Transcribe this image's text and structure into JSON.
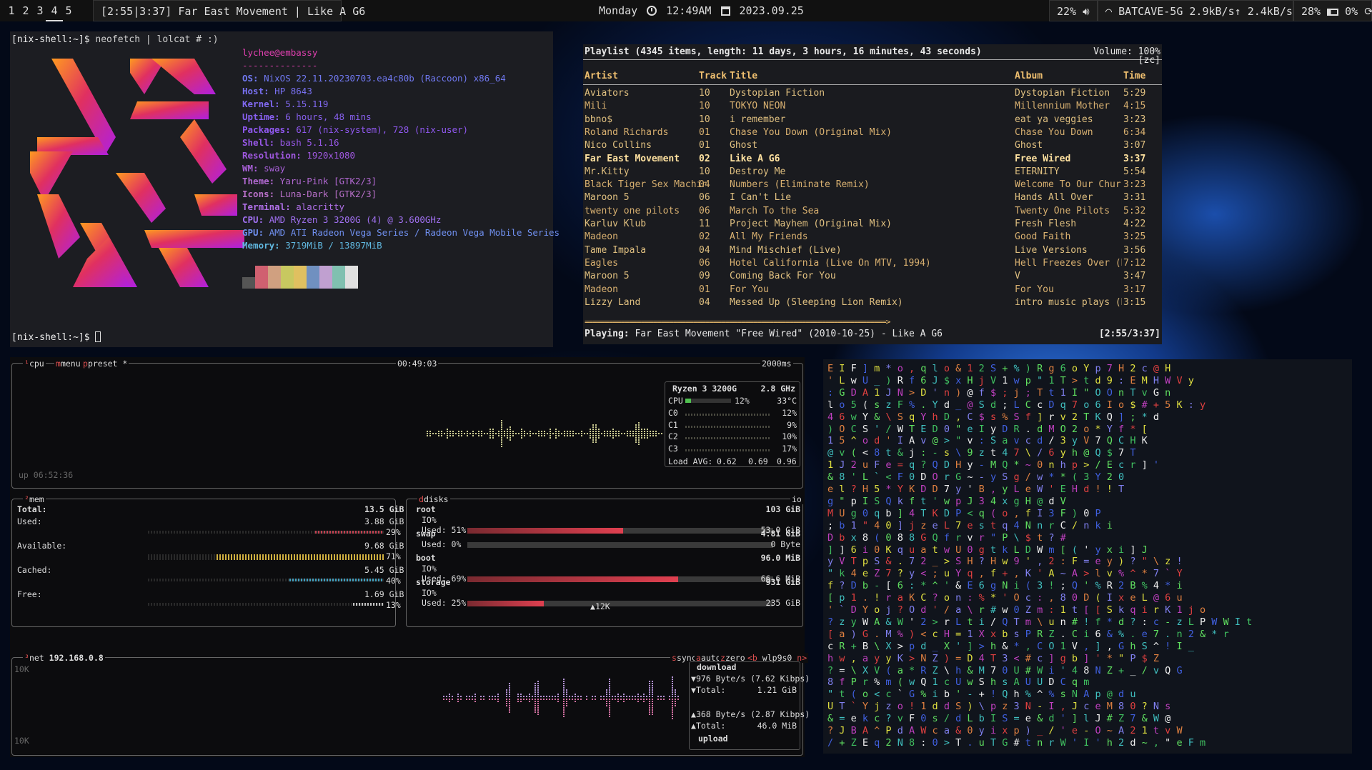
{
  "bar": {
    "workspaces": [
      "1",
      "2",
      "3",
      "4",
      "5"
    ],
    "active_workspace": "4",
    "now_playing": "[2:55|3:37] Far East Movement | Like A G6",
    "day": "Monday",
    "time": "12:49AM",
    "date": "2023.09.25",
    "volume": "22%",
    "wifi": "BATCAVE-5G 2.9kB/s",
    "wifi_down": "2.4kB/s",
    "battery": "28%",
    "brightness": "0%",
    "icons": [
      "clock-icon",
      "calendar-icon",
      "speaker-icon",
      "wifi-icon",
      "upload-arrow-icon",
      "download-arrow-icon",
      "battery-icon",
      "refresh-icon"
    ]
  },
  "neofetch": {
    "cmd_prompt": "[nix-shell:~]$",
    "command": " neofetch | lolcat # :)",
    "user": "lychee@embassy",
    "sep": "--------------",
    "lines": [
      {
        "k": "OS:",
        "v": " NixOS 22.11.20230703.ea4c80b (Raccoon) x86_64"
      },
      {
        "k": "Host:",
        "v": " HP 8643"
      },
      {
        "k": "Kernel:",
        "v": " 5.15.119"
      },
      {
        "k": "Uptime:",
        "v": " 6 hours, 48 mins"
      },
      {
        "k": "Packages:",
        "v": " 617 (nix-system), 728 (nix-user)"
      },
      {
        "k": "Shell:",
        "v": " bash 5.1.16"
      },
      {
        "k": "Resolution:",
        "v": " 1920x1080"
      },
      {
        "k": "WM:",
        "v": " sway"
      },
      {
        "k": "Theme:",
        "v": " Yaru-Pink [GTK2/3]"
      },
      {
        "k": "Icons:",
        "v": " Luna-Dark [GTK2/3]"
      },
      {
        "k": "Terminal:",
        "v": " alacritty"
      },
      {
        "k": "CPU:",
        "v": " AMD Ryzen 3 3200G (4) @ 3.600GHz"
      },
      {
        "k": "GPU:",
        "v": " AMD ATI Radeon Vega Series / Radeon Vega Mobile Series"
      },
      {
        "k": "Memory:",
        "v": " 3719MiB / 13897MiB"
      }
    ],
    "palette": [
      "#555555",
      "#d06070",
      "#d0a080",
      "#c8c860",
      "#e0c060",
      "#7090c0",
      "#c0a0d0",
      "#80c0b0",
      "#e0e0e0"
    ],
    "final_prompt": "[nix-shell:~]$"
  },
  "ncmpcpp": {
    "header": "Playlist (4345 items, length: 11 days, 3 hours, 16 minutes, 43 seconds)",
    "volume": "Volume: 100%",
    "flags": "[zc]",
    "col_artist": "Artist",
    "col_track": "Track",
    "col_title": "Title",
    "col_album": "Album",
    "col_time": "Time",
    "rows": [
      {
        "artist": "Aviators",
        "track": "10",
        "title": "Dystopian Fiction",
        "album": "Dystopian Fiction",
        "time": "5:29"
      },
      {
        "artist": "Mili",
        "track": "10",
        "title": "TOKYO NEON",
        "album": "Millennium Mother",
        "time": "4:15"
      },
      {
        "artist": "bbno$",
        "track": "10",
        "title": "i remember",
        "album": "eat ya veggies",
        "time": "3:23"
      },
      {
        "artist": "Roland Richards",
        "track": "01",
        "title": "Chase You Down (Original Mix)",
        "album": "Chase You Down",
        "time": "6:34"
      },
      {
        "artist": "Nico Collins",
        "track": "01",
        "title": "Ghost",
        "album": "Ghost",
        "time": "3:07"
      },
      {
        "artist": "Far East Movement",
        "track": "02",
        "title": "Like A G6",
        "album": "Free Wired",
        "time": "3:37"
      },
      {
        "artist": "Mr.Kitty",
        "track": "10",
        "title": "Destroy Me",
        "album": "ETERNITY",
        "time": "5:54"
      },
      {
        "artist": "Black Tiger Sex Machin",
        "track": "04",
        "title": "Numbers (Eliminate Remix)",
        "album": "Welcome To Our Church",
        "time": "3:23"
      },
      {
        "artist": "Maroon 5",
        "track": "06",
        "title": "I Can't Lie",
        "album": "Hands All Over",
        "time": "3:31"
      },
      {
        "artist": "twenty one pilots",
        "track": "06",
        "title": "March To the Sea",
        "album": "Twenty One Pilots",
        "time": "5:32"
      },
      {
        "artist": "Karluv Klub",
        "track": "11",
        "title": "Project Mayhem (Original Mix)",
        "album": "Fresh Flesh",
        "time": "4:22"
      },
      {
        "artist": "Madeon",
        "track": "02",
        "title": "All My Friends",
        "album": "Good Faith",
        "time": "3:25"
      },
      {
        "artist": "Tame Impala",
        "track": "04",
        "title": "Mind Mischief (Live)",
        "album": "Live Versions",
        "time": "3:56"
      },
      {
        "artist": "Eagles",
        "track": "06",
        "title": "Hotel California (Live On MTV, 1994)",
        "album": "Hell Freezes Over (Re",
        "time": "7:12"
      },
      {
        "artist": "Maroon 5",
        "track": "09",
        "title": "Coming Back For You",
        "album": "V",
        "time": "3:47"
      },
      {
        "artist": "Madeon",
        "track": "01",
        "title": "For You",
        "album": "For You",
        "time": "3:17"
      },
      {
        "artist": "Lizzy Land",
        "track": "04",
        "title": "Messed Up (Sleeping Lion Remix)",
        "album": "intro music plays (Re",
        "time": "3:15"
      }
    ],
    "playing_index": 5,
    "progress_line": "===========================================================================>",
    "progress_fraction": 0.806,
    "status_label": "Playing:",
    "status_text": " Far East Movement \"Free Wired\" (2010-10-25) - Like A G6",
    "status_time": "[2:55/3:37]"
  },
  "btop": {
    "cpu_tab": "cpu",
    "menu_tab": "menu",
    "preset_tab": "preset *",
    "clock": "00:49:03",
    "interval": "2000ms",
    "uptime": "up 06:52:36",
    "cpu_name": "Ryzen 3 3200G",
    "cpu_freq": "2.8 GHz",
    "cpu_total_label": "CPU",
    "cpu_total_pct": "12%",
    "cpu_temp": "33°C",
    "cpu_total_fraction": 0.12,
    "cores": [
      {
        "name": "C0",
        "pct": "12%"
      },
      {
        "name": "C1",
        "pct": "9%"
      },
      {
        "name": "C2",
        "pct": "10%"
      },
      {
        "name": "C3",
        "pct": "17%"
      }
    ],
    "load_label": "Load AVG:",
    "load": [
      "0.62",
      "0.69",
      "0.96"
    ],
    "mem": {
      "title": "mem",
      "total_label": "Total:",
      "total": "13.5 GiB",
      "used_label": "Used:",
      "used": "3.88 GiB",
      "used_pct": "29%",
      "used_frac": 0.29,
      "avail_label": "Available:",
      "avail": "9.68 GiB",
      "avail_pct": "71%",
      "avail_frac": 0.71,
      "cached_label": "Cached:",
      "cached": "5.45 GiB",
      "cached_pct": "40%",
      "cached_frac": 0.4,
      "free_label": "Free:",
      "free": "1.69 GiB",
      "free_pct": "13%",
      "free_frac": 0.13
    },
    "disks": {
      "title": "disks",
      "io_tag": "io",
      "items": [
        {
          "name": "root",
          "size": "103 GiB",
          "io": "IO%",
          "used_label": "Used: 51%",
          "used_frac": 0.51,
          "used": "53.0 GiB"
        },
        {
          "name": "swap",
          "size": "4.81 GiB",
          "io": "",
          "used_label": "Used:  0%",
          "used_frac": 0.0,
          "used": "0 Byte"
        },
        {
          "name": "boot",
          "size": "96.0 MiB",
          "io": "IO%",
          "used_label": "Used: 69%",
          "used_frac": 0.69,
          "used": "66.6 MiB"
        },
        {
          "name": "storage",
          "size": "931 GiB",
          "io": "IO%",
          "used_label": "Used: 25%",
          "used_frac": 0.25,
          "used": "235 GiB"
        }
      ],
      "io_marker": "12K"
    },
    "net": {
      "title": "net",
      "ip": "192.168.0.8",
      "sync": "sync",
      "auto": "auto",
      "zero": "zero",
      "iface_prev": "<b",
      "iface": "wlp9s0",
      "iface_next": "n>",
      "scale_top": "10K",
      "scale_bottom": "10K",
      "download_label": "download",
      "down_rate": "976 Byte/s (7.62 Kibps)",
      "down_total_label": "Total:",
      "down_total": "1.21 GiB",
      "up_rate": "368 Byte/s (2.87 Kibps)",
      "up_total_label": "Total:",
      "up_total": "46.0 MiB",
      "upload_label": "upload"
    }
  },
  "matrix_rows": [
    "  E I    F ]  m * o ,  q l    o &       1      2   S + % )     R        g              6      o         Y p 7   H 2 c   @   H",
    "   ' L    w U   _ ) R f 6 J $   x H      j      V 1 w p \" 1     T        >              t      d         9 :     E M H W V   y",
    "   : G    D A   1 J N   > D '   n )      @      f $ ; j     ;   T        t              1      I         \" O     O n T v G   n",
    "  l o     5 (   s z F   % . Y   d _      @      S d ; L C     c D   q    7    o         6      I         o $   # + 5 K :   y",
    "  4 6      w Y   &      \\ S q   Y h      D      , C $ s %     S f   ]    r    v         2                  T K   Q ] ; *   d",
    "  )    O    C S     ' / W   T E D        0      \" e I y D     R .   d    M    O         2                  o * Y f *   [",
    "  1     5 ^   o d '   I  A      v      @ > \" v :   S a   v    c    d       /    3          y      V      7   Q C H K",
    "  @ v     (     < 8   t & j   :   -      s      \\ 9 z   t     4    7   \\ /   6   y        h         @ Q $ 7 T",
    "  1 J 2   u   F e =    q ?   Q   D      H      y - M   Q     *    ~   0 n h   p   >        /         E c r ] '",
    "  & 8 '     L ` <   F   0   D        O      r G ~      -    y    S   g /   w    * *   (         3   Y 2 0",
    "  e l     ? H 5   * Y K     D   D      7      y  '  B     ,    y    L   e   W   '      E          H d ! ! T",
    "  g \"     p   I   S   Q    k      f t '     w    p    J    3    4 x g     H   @ d   V",
    "  M U    g   0   q   b   ]    4      T    K    D     P     <     q    ( o , f I    3 F   ) 0 P",
    "  ; b    1   \" 4 0 ]   j z   e   L   7     e    s    t     q    4 N n r C    / n    k i",
    "  D b    x   8 ( 0     8     8    G      Q   f     r v        r            \" P \\    $ t   ? #",
    "  ] ]    6   i   0 K q   u a t   w   U     0 g    t     k L   D W m [ (   ' y x   i ]   J",
    "  y V T   p S   &   . 7 2   _ >   S   H   ?     H w   9     ' ,   2 : F = e   y ) ?   \" \\ z !",
    "  \" k    4 e   Z 7   ? y <   ; u   Y q , f     + ,   K   '   A ~ A > l v   % ^ *   7 ` Y",
    "  f ?    D b   - [   6 : *     ^   ' & E   6     g N   i   (   3 ! ; Q ' %   R 2 B   % 4 * i",
    "  [ p    1 . !   r a K C   ?     o n : %   *     ' O   c :   ,   8 0   D ( I   x e L   @ 6 u",
    "  '   ` D   Y o j   ?     O d ' /   a \\    r #   w 0    Z m :   1 t [ [   S k q i   r K 1 j o",
    "  ?   z y W   A & W ' 2     > r L t i   / Q    T m   \\ u    n   # ! f   * d ?   : c - z L P W W I t",
    "  [ a   )   G .   M % ) < c   H     = 1 X x   b s    P R   Z .   C   i 6 &   % .   e 7 . n   2 & * r",
    "  c   R   + B   \\ X   > p   d     _ X ' ]   > h     & *     ,   C   O 1 V ,   ]   , G h S   ^ ! I _",
    "  h w   ,   a y   y K   > N   Z   ) = D   4 T     3 <   #   c ] g   b   ] ' * \" P   $ Z",
    "  ? =   \\ X V   ( a   *   R   Z   \\ h & M   7 0     U     #   W   i   ' 4 8 N Z   + _   / v   Q G",
    "  8 f    P   r % m ( w   Q     1 c   U w     S   h s A   U   U   D C q   m",
    "  \" t   ( o < c ` G % i   b   ' -   + !   Q   h     %   ^ % s   N   A   p @   d   u",
    "  U T   ` Y j z o ! 1 d   d   S ) \\ p   z   3   N   -   I ,   J c e   M   8   0   ? N s",
    "  & =   e k c ? v F 0 s   /   d L b I   S   =   e   &   d   ' ] l   J   #   Z   7 & W   @",
    "  ? J   B A ^ P d A W c   a   & 0   y i x p   )   _   /   ' e   -   O   ~   A   2   1   t v W",
    "  / +   Z E q 2 N 8 : 0   >   T . u T G # t n r W   '     I   ' h 2   d   ~   , \"   e F m"
  ]
}
